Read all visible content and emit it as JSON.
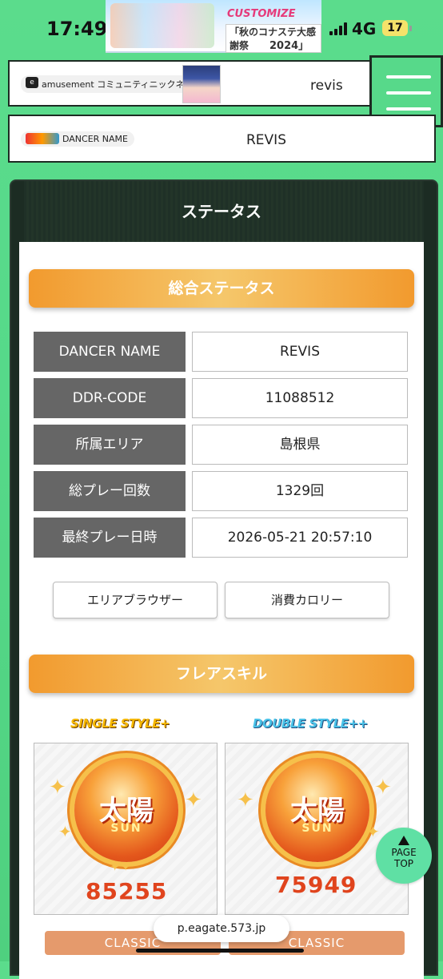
{
  "status_bar": {
    "time": "17:49",
    "network": "4G",
    "battery": "17",
    "banner": {
      "line1": "CUSTOMIZE",
      "line2": "「秋のコナステ大感謝祭",
      "line3": "2024」"
    }
  },
  "profile": {
    "community_label": "amusement コミュニティニックネーム",
    "community_name": "revis",
    "dancer_label": "DANCER NAME",
    "dancer_name": "REVIS"
  },
  "panel": {
    "title": "ステータス"
  },
  "overall_status": {
    "heading": "総合ステータス",
    "rows": [
      {
        "label": "DANCER NAME",
        "value": "REVIS"
      },
      {
        "label": "DDR-CODE",
        "value": "11088512"
      },
      {
        "label": "所属エリア",
        "value": "島根県"
      },
      {
        "label": "総プレー回数",
        "value": "1329回"
      },
      {
        "label": "最終プレー日時",
        "value": "2026-05-21 20:57:10"
      }
    ]
  },
  "buttons": {
    "area_browser": "エリアブラウザー",
    "calories": "消費カロリー"
  },
  "flare_skill": {
    "heading": "フレアスキル",
    "single": {
      "style": "SINGLE STYLE+",
      "rank_kanji": "太陽",
      "rank_en": "SUN",
      "score": "85255",
      "classic": "CLASSIC"
    },
    "double": {
      "style": "DOUBLE STYLE++",
      "rank_kanji": "太陽",
      "rank_en": "SUN",
      "score": "75949",
      "classic": "CLASSIC"
    }
  },
  "page_top": "PAGE TOP",
  "url": "p.eagate.573.jp"
}
